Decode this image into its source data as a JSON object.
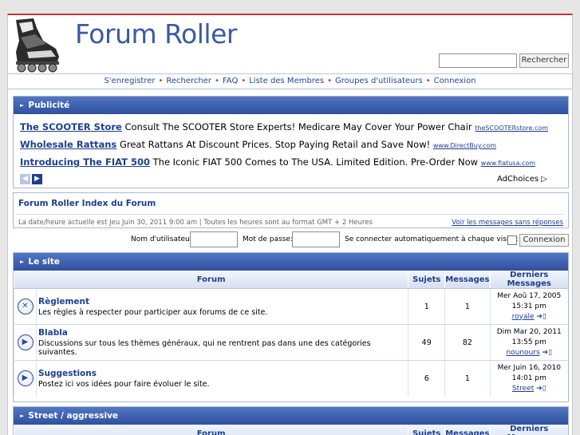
{
  "site": {
    "title": "Forum Roller"
  },
  "search": {
    "value": "",
    "button_label": "Rechercher"
  },
  "nav": {
    "items": [
      "S'enregistrer",
      "Rechercher",
      "FAQ",
      "Liste des Membres",
      "Groupes d'utilisateurs",
      "Connexion"
    ],
    "separator": "•"
  },
  "ads": {
    "header": "Publicité",
    "items": [
      {
        "title": "The SCOOTER Store",
        "text": "Consult The SCOOTER Store Experts! Medicare May Cover Your Power Chair",
        "url": "theSCOOTERstore.com"
      },
      {
        "title": "Wholesale Rattans",
        "text": "Great Rattans At Discount Prices. Stop Paying Retail and Save Now!",
        "url": "www.DirectBuy.com"
      },
      {
        "title": "Introducing The FIAT 500",
        "text": "The Iconic FIAT 500 Comes to The USA. Limited Edition. Pre-Order Now",
        "url": "www.fiatusa.com"
      }
    ],
    "adchoices": "AdChoices ▷"
  },
  "index": {
    "title": "Forum Roller Index du Forum",
    "datetime": "La date/heure actuelle est Jeu Juin 30, 2011 9:00 am | Toutes les heures sont au format GMT + 2 Heures",
    "unanswered_link": "Voir les messages sans réponses"
  },
  "login": {
    "username_label": "Nom d'utilisateur:",
    "username_value": "",
    "password_label": "Mot de passe:",
    "password_value": "",
    "autologin_label": "Se connecter automatiquement à chaque visite:",
    "button_label": "Connexion"
  },
  "categories": [
    {
      "name": "Le site",
      "columns": [
        "Forum",
        "Sujets",
        "Messages",
        "Derniers Messages"
      ],
      "forums": [
        {
          "name": "Règlement",
          "desc": "Les règles à respecter pour participer aux forums de ce site.",
          "topics": "1",
          "posts": "1",
          "last_date": "Mer Aoû 17, 2005",
          "last_time": "15:31 pm",
          "last_user": "royale",
          "icon": "locked-forum-icon"
        },
        {
          "name": "Blabla",
          "desc": "Discussions sur tous les thèmes généraux, qui ne rentrent pas dans une des catégories suivantes.",
          "topics": "49",
          "posts": "82",
          "last_date": "Dim Mar 20, 2011",
          "last_time": "13:55 pm",
          "last_user": "nounours",
          "icon": "forum-icon"
        },
        {
          "name": "Suggestions",
          "desc": "Postez ici vos idées pour faire évoluer le site.",
          "topics": "6",
          "posts": "1",
          "last_date": "Mer Juin 16, 2010",
          "last_time": "14:01 pm",
          "last_user": "Street",
          "icon": "forum-icon"
        }
      ]
    },
    {
      "name": "Street / aggressive",
      "columns": [
        "Forum",
        "Sujets",
        "Messages",
        "Derniers Messages"
      ]
    }
  ],
  "colors": {
    "accent": "#3a5aa4",
    "header_bar": "#2f50a0",
    "top_border": "#cc3333"
  }
}
